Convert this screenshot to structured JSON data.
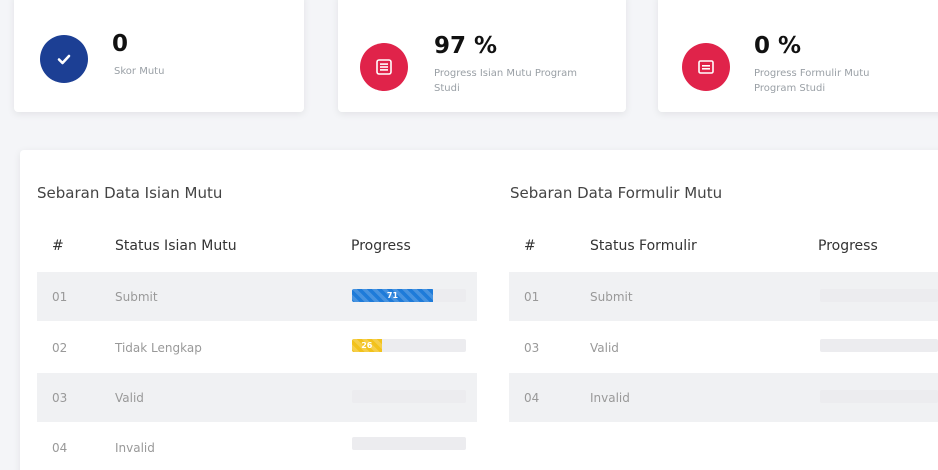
{
  "colors": {
    "check_icon_bg": "#1c3f94",
    "red_icon_bg": "#e0234a",
    "progress_blue": "#1e7bd9",
    "progress_yellow": "#f2c21b",
    "row_stripe": "#f0f1f3"
  },
  "stats": [
    {
      "value": "0",
      "label": "Skor Mutu",
      "icon": "check-circle-icon"
    },
    {
      "value": "97 %",
      "label": "Progress Isian Mutu Program Studi",
      "icon": "list-icon"
    },
    {
      "value": "0 %",
      "label": "Progress Formulir Mutu Program Studi",
      "icon": "form-icon"
    }
  ],
  "isian": {
    "title": "Sebaran Data Isian Mutu",
    "headers": {
      "num": "#",
      "status": "Status Isian Mutu",
      "progress": "Progress"
    },
    "rows": [
      {
        "num": "01",
        "status": "Submit",
        "progress": 0.71,
        "progress_label": "71",
        "color": "blue"
      },
      {
        "num": "02",
        "status": "Tidak Lengkap",
        "progress": 0.26,
        "progress_label": "26",
        "color": "yellow"
      },
      {
        "num": "03",
        "status": "Valid",
        "progress": 0,
        "progress_label": "",
        "color": "none"
      },
      {
        "num": "04",
        "status": "Invalid",
        "progress": 0,
        "progress_label": "",
        "color": "none"
      }
    ]
  },
  "formulir": {
    "title": "Sebaran Data Formulir Mutu",
    "headers": {
      "num": "#",
      "status": "Status Formulir",
      "progress": "Progress"
    },
    "rows": [
      {
        "num": "01",
        "status": "Submit",
        "progress": 0
      },
      {
        "num": "03",
        "status": "Valid",
        "progress": 0
      },
      {
        "num": "04",
        "status": "Invalid",
        "progress": 0
      }
    ]
  }
}
